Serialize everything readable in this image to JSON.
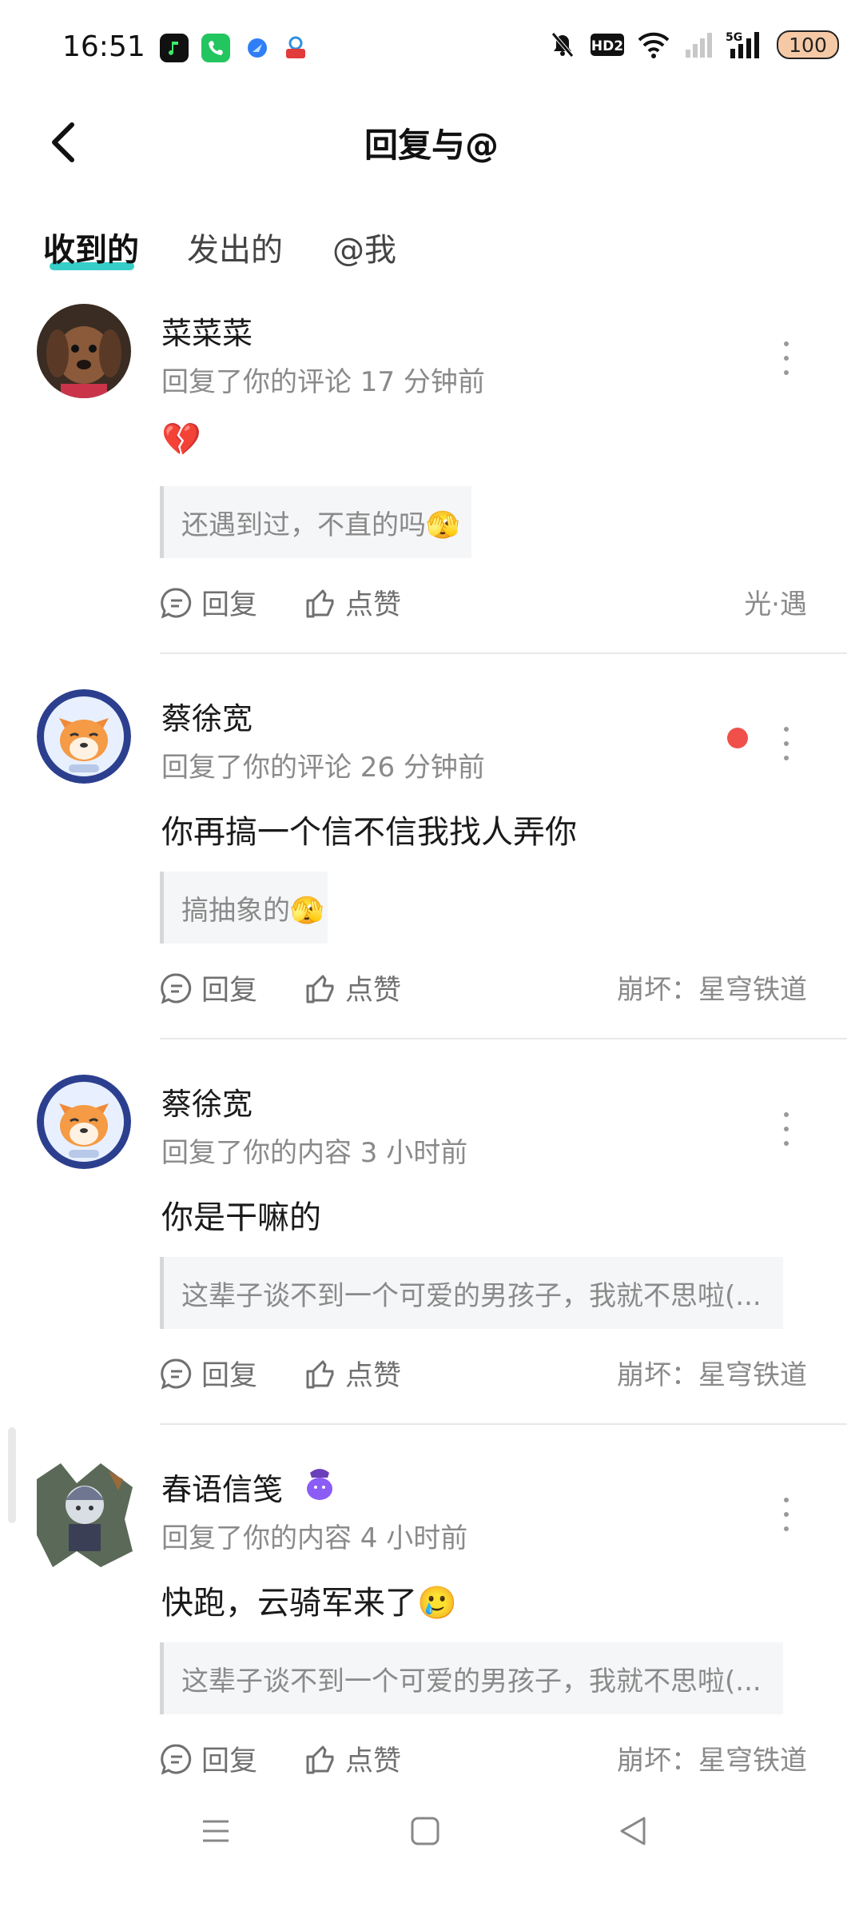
{
  "status_bar": {
    "time": "16:51",
    "battery": "100",
    "icons": [
      "music-app-icon",
      "phone-app-icon",
      "browser-app-icon",
      "mobile-app-icon",
      "mute-icon",
      "hd-icon",
      "wifi-icon",
      "signal-icon",
      "5g-signal-icon"
    ]
  },
  "header": {
    "title": "回复与@"
  },
  "tabs": [
    {
      "label": "收到的",
      "active": true
    },
    {
      "label": "发出的",
      "active": false
    },
    {
      "label": "@我",
      "active": false
    }
  ],
  "colors": {
    "accent": "#20c9c3",
    "unread_dot": "#f0504a",
    "battery": "#f6c9a6"
  },
  "items": [
    {
      "name": "菜菜菜",
      "meta": "回复了你的评论 17 分钟前",
      "content": "💔",
      "quote": "还遇到过，不直的吗🫣",
      "reply": "回复",
      "like": "点赞",
      "source": "光·遇",
      "unread": false
    },
    {
      "name": "蔡徐宽",
      "meta": "回复了你的评论 26 分钟前",
      "content": "你再搞一个信不信我找人弄你",
      "quote": "搞抽象的🫣",
      "reply": "回复",
      "like": "点赞",
      "source": "崩坏：星穹铁道",
      "unread": true
    },
    {
      "name": "蔡徐宽",
      "meta": "回复了你的内容 3 小时前",
      "content": "你是干嘛的",
      "quote": "这辈子谈不到一个可爱的男孩子，我就不思啦(...",
      "reply": "回复",
      "like": "点赞",
      "source": "崩坏：星穹铁道",
      "unread": false
    },
    {
      "name": "春语信笺",
      "meta": "回复了你的内容 4 小时前",
      "content": "快跑，云骑军来了🥲",
      "quote": "这辈子谈不到一个可爱的男孩子，我就不思啦(...",
      "reply": "回复",
      "like": "点赞",
      "source": "崩坏：星穹铁道",
      "unread": false
    }
  ],
  "navbar": [
    "menu-icon",
    "home-icon",
    "back-icon"
  ]
}
